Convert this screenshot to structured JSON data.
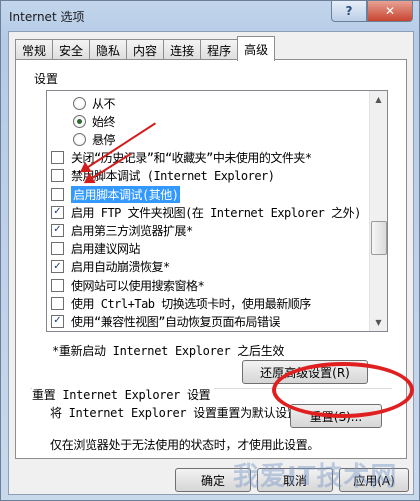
{
  "window": {
    "title": "Internet 选项",
    "help_icon": "question-mark-icon",
    "close_icon": "close-x-icon"
  },
  "tabs": [
    "常规",
    "安全",
    "隐私",
    "内容",
    "连接",
    "程序",
    "高级"
  ],
  "active_tab": "高级",
  "settings": {
    "label": "设置",
    "items": [
      {
        "type": "radio",
        "label": "从不",
        "checked": false
      },
      {
        "type": "radio",
        "label": "始终",
        "checked": true
      },
      {
        "type": "radio",
        "label": "悬停",
        "checked": false
      },
      {
        "type": "checkbox",
        "label": "关闭“历史记录”和“收藏夹”中未使用的文件夹*",
        "checked": false
      },
      {
        "type": "checkbox",
        "label": "禁用脚本调试 (Internet Explorer)",
        "checked": false
      },
      {
        "type": "checkbox",
        "label": "启用脚本调试(其他)",
        "checked": false,
        "selected": true
      },
      {
        "type": "checkbox",
        "label": "启用 FTP 文件夹视图(在 Internet Explorer 之外)",
        "checked": true
      },
      {
        "type": "checkbox",
        "label": "启用第三方浏览器扩展*",
        "checked": true
      },
      {
        "type": "checkbox",
        "label": "启用建议网站",
        "checked": false
      },
      {
        "type": "checkbox",
        "label": "启用自动崩溃恢复*",
        "checked": true
      },
      {
        "type": "checkbox",
        "label": "使网站可以使用搜索窗格*",
        "checked": false
      },
      {
        "type": "checkbox",
        "label": "使用 Ctrl+Tab 切换选项卡时，使用最新顺序",
        "checked": false
      },
      {
        "type": "checkbox",
        "label": "使用“兼容性视图”自动恢复页面布局错误",
        "checked": true
      }
    ],
    "note": "*重新启动 Internet Explorer 之后生效",
    "restore_button": "还原高级设置(R)"
  },
  "reset_section": {
    "heading": "重置 Internet Explorer 设置",
    "description": "将 Internet Explorer 设置重置为默认设置。",
    "reset_button": "重置(S)...",
    "hint": "仅在浏览器处于无法使用的状态时，才使用此设置。"
  },
  "footer": {
    "ok": "确定",
    "cancel": "取消",
    "apply": "应用(A)"
  },
  "annotation_color": "#e02020",
  "watermark": "我爱IT技术网"
}
